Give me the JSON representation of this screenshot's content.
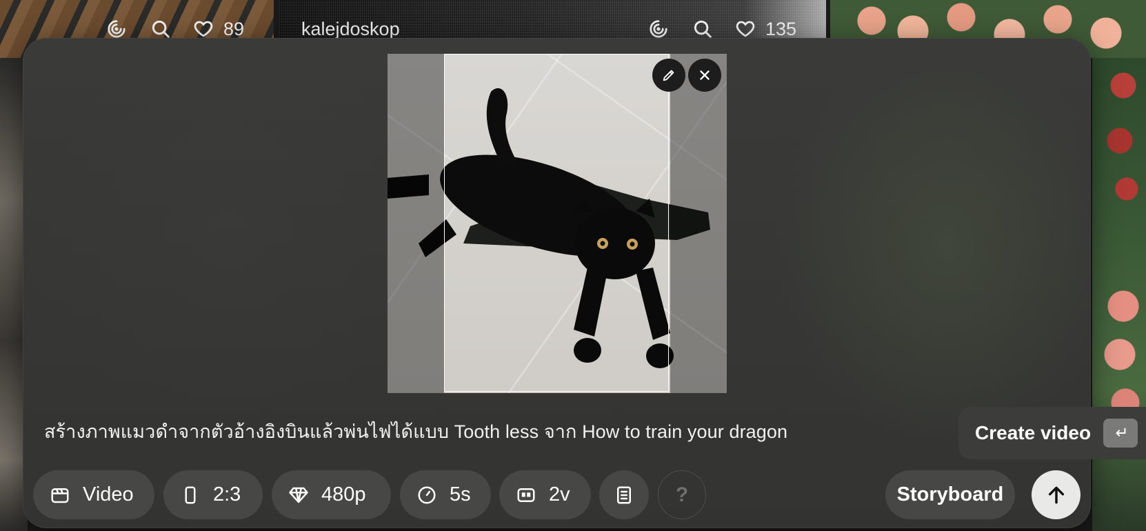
{
  "gallery": {
    "tile_left": {
      "likes": "89",
      "icons": [
        "remix-icon",
        "search-icon",
        "heart-icon"
      ]
    },
    "tile_middle": {
      "author": "kalejdoskop",
      "likes": "135",
      "icons": [
        "remix-icon",
        "search-icon",
        "heart-icon"
      ]
    }
  },
  "composer": {
    "preview": {
      "edit_icon": "pencil-icon",
      "close_icon": "close-icon"
    },
    "prompt_text": "สร้างภาพแมวดำจากตัวอ้างอิงบินแล้วพ่นไฟได้แบบ Tooth less จาก How to train your dragon",
    "create_label": "Create video",
    "create_shortcut_icon": "enter-key-icon"
  },
  "toolbar": {
    "type": "Video",
    "aspect_ratio": "2:3",
    "resolution": "480p",
    "duration": "5s",
    "variations": "2v",
    "help": "?",
    "storyboard": "Storyboard",
    "submit_icon": "arrow-up-icon"
  },
  "colors": {
    "panel": "#363634",
    "chip": "#474745",
    "submit": "#e9e9e7"
  }
}
